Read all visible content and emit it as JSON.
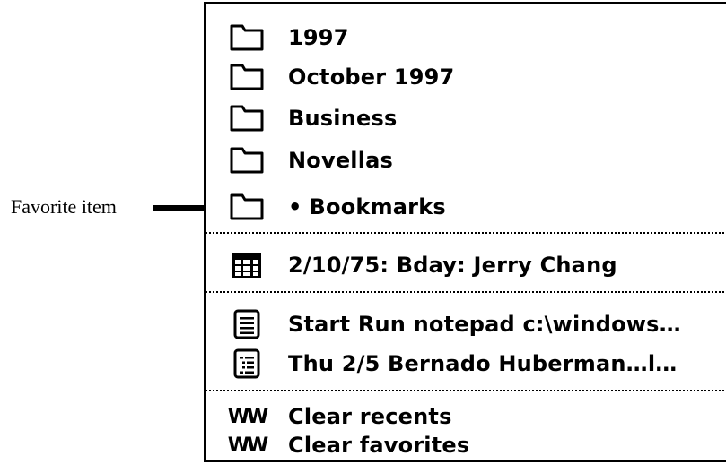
{
  "callout": {
    "label": "Favorite item"
  },
  "menu": {
    "folders": [
      {
        "label": "1997",
        "icon": "folder-icon"
      },
      {
        "label": "October 1997",
        "icon": "folder-icon"
      },
      {
        "label": "Business",
        "icon": "folder-icon"
      },
      {
        "label": "Novellas",
        "icon": "folder-icon"
      },
      {
        "label": "Bookmarks",
        "icon": "folder-icon",
        "favorite_marker": "•"
      }
    ],
    "calendar": {
      "label": "2/10/75: Bday: Jerry Chang",
      "icon": "calendar-icon"
    },
    "documents": [
      {
        "label": "Start Run notepad c:\\windows…",
        "icon": "document-icon"
      },
      {
        "label": "Thu 2/5 Bernado Huberman…l…",
        "icon": "list-document-icon"
      }
    ],
    "actions": [
      {
        "label": "Clear recents",
        "icon": "ww-icon",
        "glyph": "WW"
      },
      {
        "label": "Clear favorites",
        "icon": "ww-icon",
        "glyph": "WW"
      }
    ]
  }
}
